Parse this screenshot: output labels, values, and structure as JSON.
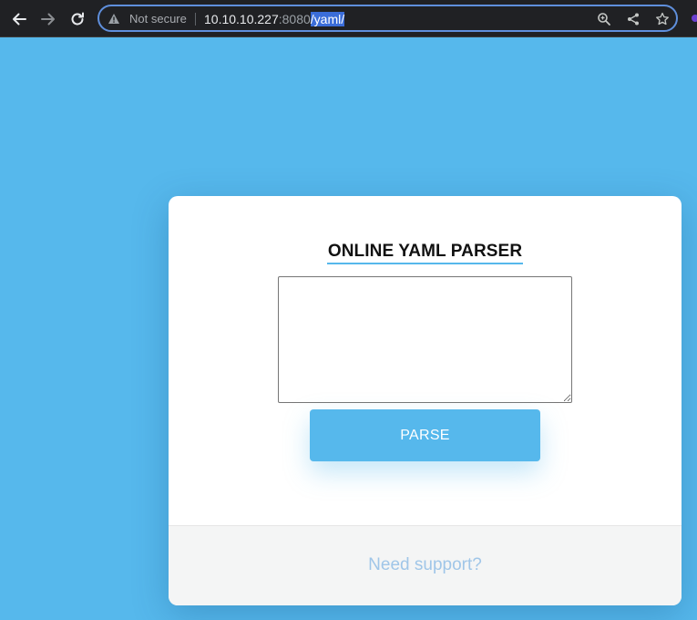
{
  "browser": {
    "security_label": "Not secure",
    "url_host": "10.10.10.227",
    "url_port": ":8080",
    "url_path": "/yaml/",
    "accent_color": "#5f8fdc",
    "icons": [
      "back-arrow-icon",
      "forward-arrow-icon",
      "reload-icon",
      "warning-icon",
      "zoom-icon",
      "share-icon",
      "bookmark-star-icon"
    ]
  },
  "page": {
    "background_color": "#56b8ec",
    "title": "ONLINE YAML PARSER",
    "textarea_value": "",
    "parse_button_label": "PARSE",
    "support_link_label": "Need support?"
  }
}
